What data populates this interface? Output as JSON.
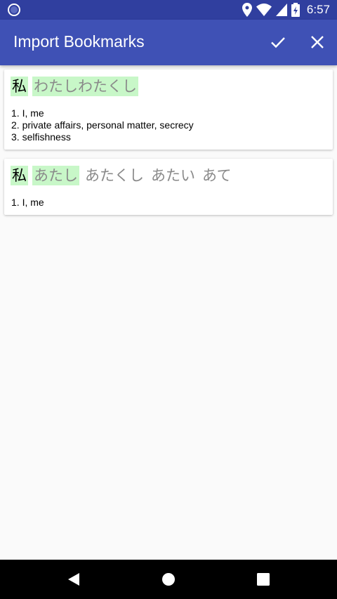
{
  "status_bar": {
    "time": "6:57",
    "left_icon": "notification-circle-icon",
    "icons": [
      "location-icon",
      "wifi-icon",
      "signal-icon",
      "battery-charging-icon"
    ]
  },
  "app_bar": {
    "title": "Import Bookmarks",
    "confirm_icon": "check-icon",
    "close_icon": "close-icon"
  },
  "colors": {
    "status_bar": "#303f9f",
    "app_bar": "#3f51b5",
    "highlight": "#c8f7c8",
    "reading_text": "#8a8a8a"
  },
  "bookmarks": [
    {
      "kanji": "私",
      "readings": [
        "わたしわたくし"
      ],
      "meanings": [
        "1. I, me",
        "2. private affairs, personal matter, secrecy",
        "3. selfishness"
      ]
    },
    {
      "kanji": "私",
      "readings": [
        "あたし",
        "あたくし",
        "あたい",
        "あて"
      ],
      "meanings": [
        "1. I, me"
      ]
    }
  ],
  "nav_bar": {
    "back_icon": "back-triangle-icon",
    "home_icon": "home-circle-icon",
    "recents_icon": "recents-square-icon"
  }
}
